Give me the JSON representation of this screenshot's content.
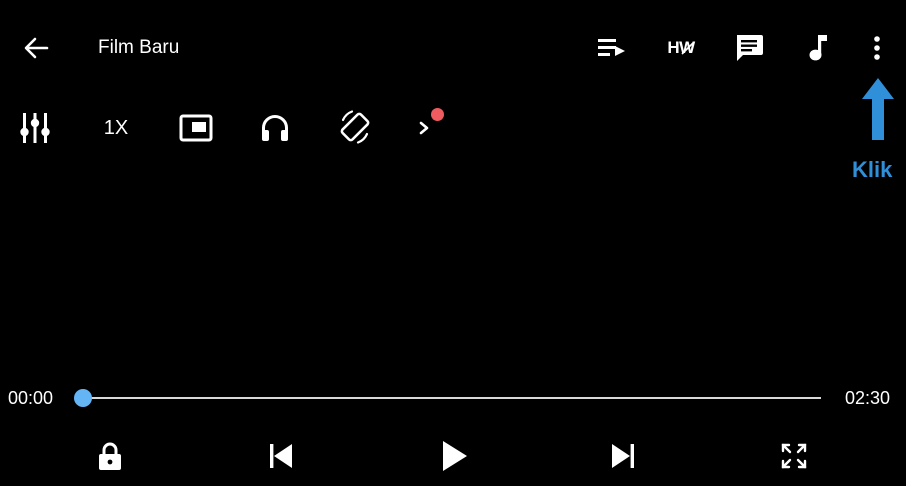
{
  "colors": {
    "background": "#000000",
    "foreground": "#ffffff",
    "accent": "#64b5f6",
    "annotation": "#2f8fd8",
    "notification_dot": "#f05b60"
  },
  "top_bar": {
    "back_icon": "arrow-left-icon",
    "title": "Film Baru",
    "playlist_icon": "playlist-play-icon",
    "hw_label": "HW",
    "subtitle_icon": "subtitle-message-icon",
    "music_icon": "music-note-icon",
    "more_icon": "more-vertical-icon"
  },
  "toolbar": {
    "equalizer_icon": "equalizer-sliders-icon",
    "speed_label": "1X",
    "pip_icon": "picture-in-picture-icon",
    "headphones_icon": "headphones-icon",
    "rotate_icon": "screen-rotation-icon",
    "expand_icon": "chevron-right-icon"
  },
  "annotation": {
    "label": "Klik",
    "arrow_icon": "arrow-up-icon"
  },
  "progress": {
    "current_time": "00:00",
    "total_time": "02:30",
    "fraction": 0.0
  },
  "controls": {
    "lock_icon": "lock-icon",
    "previous_icon": "skip-previous-icon",
    "play_icon": "play-icon",
    "next_icon": "skip-next-icon",
    "fullscreen_icon": "fullscreen-expand-icon"
  }
}
